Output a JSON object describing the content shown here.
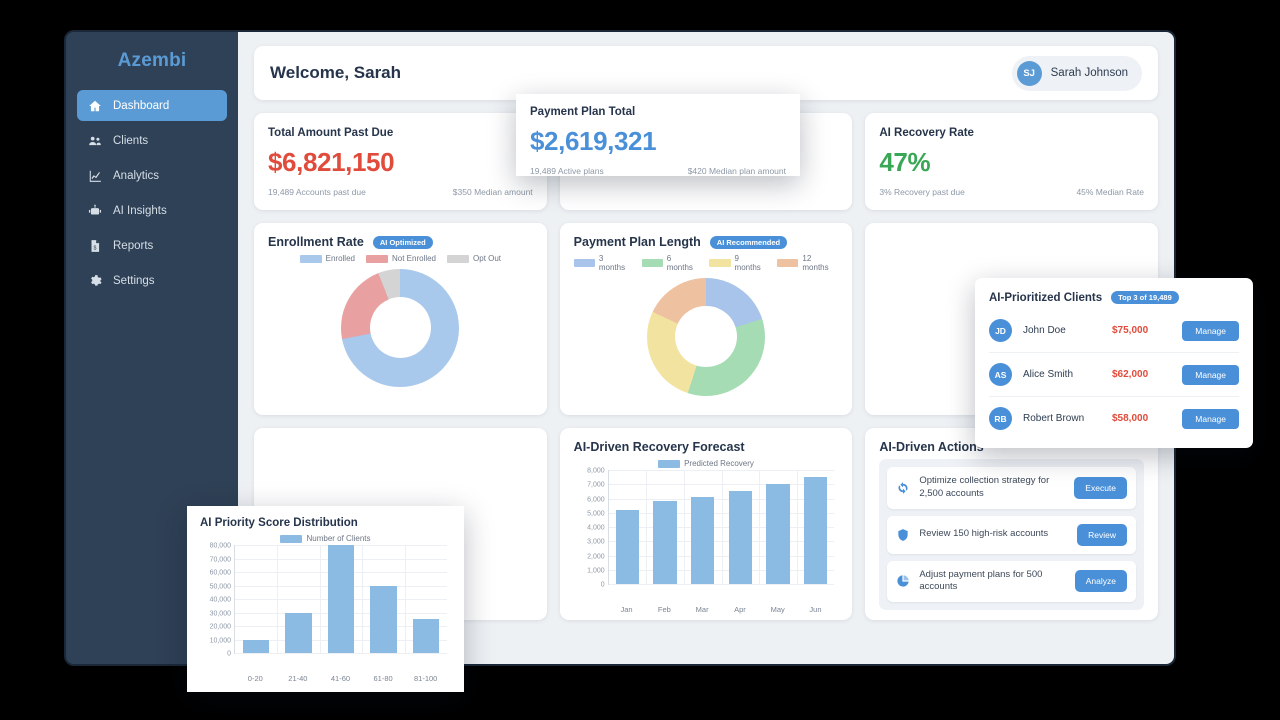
{
  "brand": {
    "name": "Azembi"
  },
  "sidebar": {
    "items": [
      {
        "label": "Dashboard",
        "icon": "home-icon",
        "active": true
      },
      {
        "label": "Clients",
        "icon": "users-icon",
        "active": false
      },
      {
        "label": "Analytics",
        "icon": "chart-line-icon",
        "active": false
      },
      {
        "label": "AI Insights",
        "icon": "robot-icon",
        "active": false
      },
      {
        "label": "Reports",
        "icon": "report-icon",
        "active": false
      },
      {
        "label": "Settings",
        "icon": "gear-icon",
        "active": false
      }
    ]
  },
  "header": {
    "welcome": "Welcome, Sarah",
    "user": {
      "initials": "SJ",
      "name": "Sarah Johnson"
    }
  },
  "stats": {
    "past_due": {
      "title": "Total Amount Past Due",
      "value": "$6,821,150",
      "foot_left": "19,489 Accounts past due",
      "foot_right": "$350 Median amount",
      "color": "#e14b3b"
    },
    "recovery_rate": {
      "title": "AI Recovery Rate",
      "value": "47%",
      "foot_left": "3% Recovery past due",
      "foot_right": "45% Median Rate",
      "color": "#3aa757"
    }
  },
  "payment_popup": {
    "title": "Payment Plan Total",
    "value": "$2,619,321",
    "foot_left": "19,489 Active plans",
    "foot_right": "$420 Median plan amount",
    "color": "#4a90d9"
  },
  "clients_popup": {
    "title": "AI-Prioritized Clients",
    "badge": "Top 3 of 19,489",
    "rows": [
      {
        "initials": "JD",
        "name": "John Doe",
        "amount": "$75,000",
        "action": "Manage"
      },
      {
        "initials": "AS",
        "name": "Alice Smith",
        "amount": "$62,000",
        "action": "Manage"
      },
      {
        "initials": "RB",
        "name": "Robert Brown",
        "amount": "$58,000",
        "action": "Manage"
      }
    ]
  },
  "actions": {
    "title": "AI-Driven Actions",
    "items": [
      {
        "icon": "sync-icon",
        "text": "Optimize collection strategy for 2,500 accounts",
        "button": "Execute"
      },
      {
        "icon": "shield-icon",
        "text": "Review 150 high-risk accounts",
        "button": "Review"
      },
      {
        "icon": "pie-icon",
        "text": "Adjust payment plans for 500 accounts",
        "button": "Analyze"
      }
    ]
  },
  "chart_data": [
    {
      "id": "enrollment",
      "type": "pie",
      "title": "Enrollment Rate",
      "badge": "AI Optimized",
      "legend_position": "top",
      "labels": [
        "Enrolled",
        "Not Enrolled",
        "Opt Out"
      ],
      "values": [
        72,
        22,
        6
      ],
      "colors": [
        "#a8c8ec",
        "#e8a0a0",
        "#d4d4d4"
      ]
    },
    {
      "id": "plan-length",
      "type": "pie",
      "title": "Payment Plan Length",
      "badge": "AI Recommended",
      "legend_position": "top",
      "labels": [
        "3 months",
        "6 months",
        "9 months",
        "12 months"
      ],
      "values": [
        20,
        35,
        27,
        18
      ],
      "colors": [
        "#a8c4ea",
        "#a5dcb4",
        "#f2e3a0",
        "#eec2a0"
      ]
    },
    {
      "id": "recovery-forecast",
      "type": "bar",
      "title": "AI-Driven Recovery Forecast",
      "legend": [
        "Predicted Recovery"
      ],
      "legend_position": "top",
      "categories": [
        "Jan",
        "Feb",
        "Mar",
        "Apr",
        "May",
        "Jun"
      ],
      "values": [
        5200,
        5800,
        6100,
        6500,
        7000,
        7500
      ],
      "yticks": [
        "8,000",
        "7,000",
        "6,000",
        "5,000",
        "4,000",
        "3,000",
        "2,000",
        "1,000",
        "0"
      ],
      "ylim": [
        0,
        8000
      ],
      "xlabel": "",
      "ylabel": "",
      "grid": true,
      "color": "#8bbbe3"
    },
    {
      "id": "priority-score",
      "type": "bar",
      "title": "AI Priority Score Distribution",
      "legend": [
        "Number of Clients"
      ],
      "legend_position": "top",
      "categories": [
        "0-20",
        "21-40",
        "41-60",
        "61-80",
        "81-100"
      ],
      "values": [
        10000,
        30000,
        80000,
        50000,
        25000
      ],
      "yticks": [
        "80,000",
        "70,000",
        "60,000",
        "50,000",
        "40,000",
        "30,000",
        "20,000",
        "10,000",
        "0"
      ],
      "ylim": [
        0,
        80000
      ],
      "xlabel": "",
      "ylabel": "",
      "grid": true,
      "color": "#8bbbe3"
    }
  ],
  "colors": {
    "accent": "#4a90d9",
    "sidebar": "#2f4156",
    "danger": "#e14b3b",
    "success": "#3aa757",
    "canvas": "#eef1f4"
  }
}
